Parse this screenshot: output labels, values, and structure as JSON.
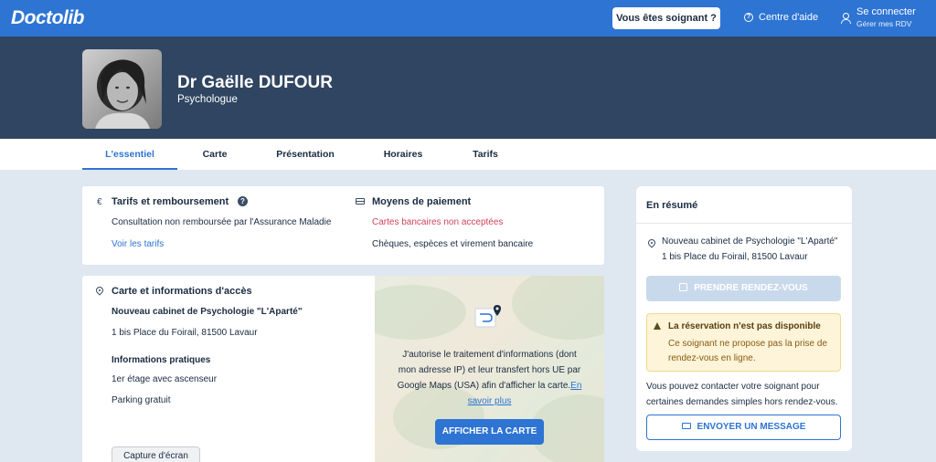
{
  "nav": {
    "logo": "Doctolib",
    "pro_button": "Vous êtes soignant ?",
    "help": "Centre d'aide",
    "login_title": "Se connecter",
    "login_sub": "Gérer mes RDV"
  },
  "doctor": {
    "name": "Dr Gaëlle DUFOUR",
    "specialty": "Psychologue"
  },
  "tabs": [
    "L'essentiel",
    "Carte",
    "Présentation",
    "Horaires",
    "Tarifs"
  ],
  "tarifs": {
    "title": "Tarifs et remboursement",
    "line": "Consultation non remboursée par l'Assurance Maladie",
    "link": "Voir les tarifs"
  },
  "paiement": {
    "title": "Moyens de paiement",
    "not_accepted": "Cartes bancaires non acceptées",
    "accepted": "Chèques, espèces et virement bancaire"
  },
  "acces": {
    "title": "Carte et informations d'accès",
    "place": "Nouveau cabinet de Psychologie \"L'Aparté\"",
    "address": "1 bis Place du Foirail, 81500 Lavaur",
    "info_title": "Informations pratiques",
    "info1": "1er étage avec ascenseur",
    "info2": "Parking gratuit"
  },
  "map": {
    "consent": "J'autorise le traitement d'informations (dont mon adresse IP) et leur transfert hors UE par Google Maps (USA) afin d'afficher la carte.",
    "learn_more": "En savoir plus",
    "button": "AFFICHER LA CARTE"
  },
  "capture": "Capture d'écran",
  "summary": {
    "title": "En résumé",
    "place": "Nouveau cabinet de Psychologie \"L'Aparté\"",
    "address": "1 bis Place du Foirail, 81500 Lavaur",
    "rdv_button": "PRENDRE RENDEZ-VOUS",
    "warn_title": "La réservation n'est pas disponible",
    "warn_body": "Ce soignant ne propose pas la prise de rendez-vous en ligne.",
    "contact": "Vous pouvez contacter votre soignant pour certaines demandes simples hors rendez-vous.",
    "msg_button": "ENVOYER UN MESSAGE"
  },
  "colors": {
    "brand": "#2d74d3",
    "header": "#2f4561",
    "alert": "#d0435a"
  }
}
